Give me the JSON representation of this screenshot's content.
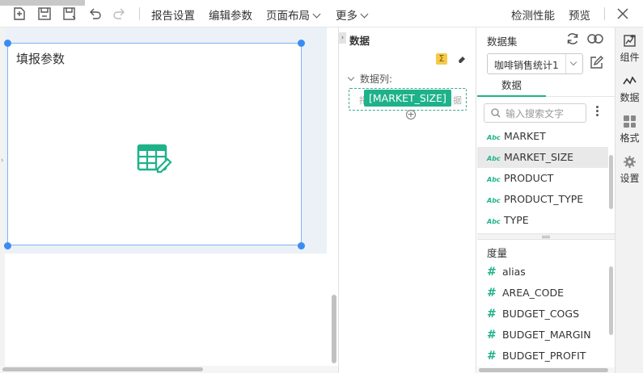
{
  "toolbar": {
    "menus": [
      "报告设置",
      "编辑参数",
      "页面布局",
      "更多"
    ],
    "right": [
      "检测性能",
      "预览"
    ]
  },
  "canvas": {
    "widget_title": "填报参数"
  },
  "data_column": {
    "title": "数据",
    "column_label": "数据列:",
    "ghost_left": "拖",
    "ghost_right": "据",
    "drag_chip": "[MARKET_SIZE]"
  },
  "dataset": {
    "title": "数据集",
    "selected_dataset": "咖啡销售统计1",
    "tab": "数据",
    "search_placeholder": "输入搜索文字",
    "dimension_fields": [
      "MARKET",
      "MARKET_SIZE",
      "PRODUCT",
      "PRODUCT_TYPE",
      "TYPE"
    ],
    "dimension_type_label": "Abc",
    "selected_field_index": 1,
    "measure_title": "度量",
    "measure_fields": [
      "alias",
      "AREA_CODE",
      "BUDGET_COGS",
      "BUDGET_MARGIN",
      "BUDGET_PROFIT"
    ]
  },
  "side_tabs": [
    "组件",
    "数据",
    "格式",
    "设置"
  ],
  "colors": {
    "accent": "#1fb28a",
    "selection": "#3b8cf0"
  }
}
